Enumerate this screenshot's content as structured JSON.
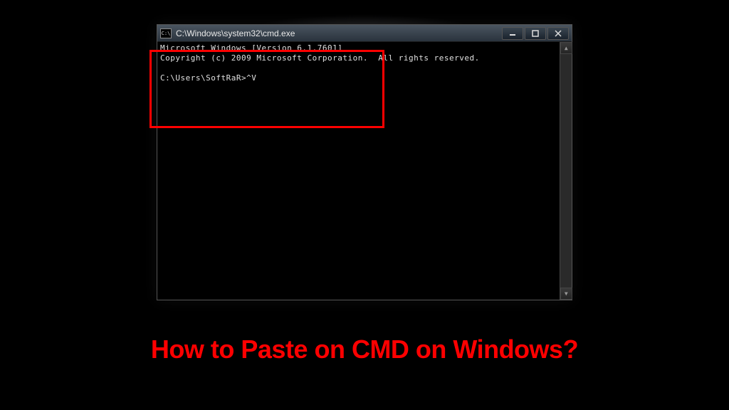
{
  "window": {
    "title": "C:\\Windows\\system32\\cmd.exe",
    "icon_label": "cmd-icon"
  },
  "terminal": {
    "line1": "Microsoft Windows [Version 6.1.7601]",
    "line2": "Copyright (c) 2009 Microsoft Corporation.  All rights reserved.",
    "prompt": "C:\\Users\\SoftRaR>^V"
  },
  "caption": "How to Paste on CMD on Windows?"
}
